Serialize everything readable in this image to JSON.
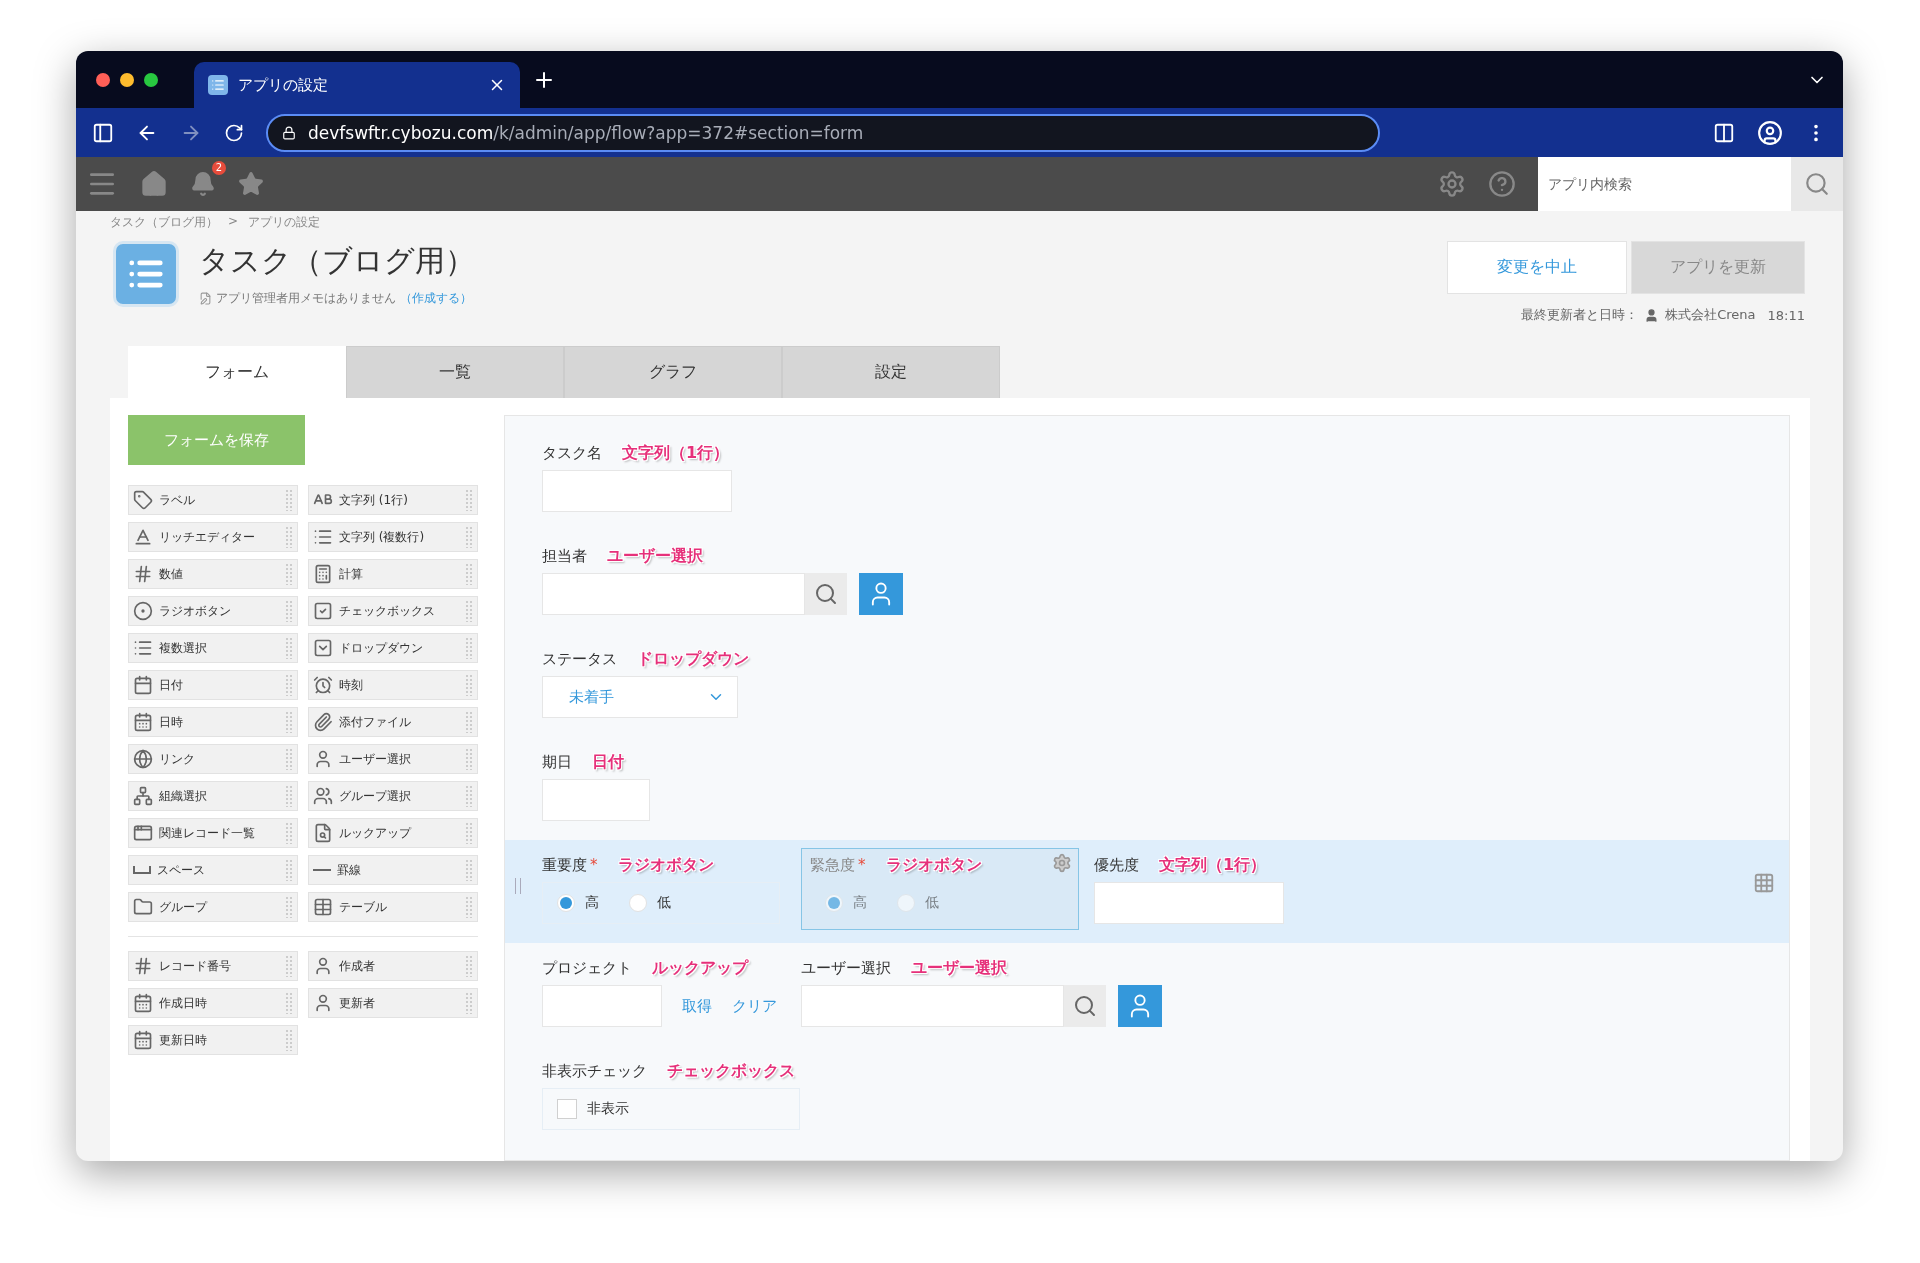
{
  "browser": {
    "tab_title": "アプリの設定",
    "url_host": "devfswftr.cybozu.com",
    "url_path": "/k/admin/app/flow?app=372#section=form"
  },
  "header": {
    "notification_count": "2",
    "search_placeholder": "アプリ内検索"
  },
  "breadcrumb": {
    "items": [
      "タスク（ブログ用）",
      "アプリの設定"
    ],
    "separator": ">"
  },
  "app": {
    "title": "タスク（ブログ用）",
    "memo": "アプリ管理者用メモはありません",
    "memo_link": "（作成する）"
  },
  "actions": [
    {
      "label": "変更を中止",
      "disabled": false
    },
    {
      "label": "アプリを更新",
      "disabled": true
    }
  ],
  "last_updated": {
    "label": "最終更新者と日時：",
    "user": "株式会社Crena",
    "time": "18:11"
  },
  "tabs": [
    {
      "label": "フォーム",
      "selected": true
    },
    {
      "label": "一覧",
      "selected": false
    },
    {
      "label": "グラフ",
      "selected": false
    },
    {
      "label": "設定",
      "selected": false
    }
  ],
  "palette": {
    "save_button": "フォームを保存",
    "groups": [
      [
        {
          "kind": "label",
          "label": "ラベル"
        },
        {
          "kind": "single_line",
          "label": "文字列 (1行)"
        },
        {
          "kind": "rich_text",
          "label": "リッチエディター"
        },
        {
          "kind": "multi_line",
          "label": "文字列 (複数行)"
        },
        {
          "kind": "number",
          "label": "数値"
        },
        {
          "kind": "calc",
          "label": "計算"
        },
        {
          "kind": "radio",
          "label": "ラジオボタン"
        },
        {
          "kind": "checkbox",
          "label": "チェックボックス"
        },
        {
          "kind": "multi_select",
          "label": "複数選択"
        },
        {
          "kind": "dropdown",
          "label": "ドロップダウン"
        },
        {
          "kind": "date",
          "label": "日付"
        },
        {
          "kind": "time",
          "label": "時刻"
        },
        {
          "kind": "datetime",
          "label": "日時"
        },
        {
          "kind": "file",
          "label": "添付ファイル"
        },
        {
          "kind": "link",
          "label": "リンク"
        },
        {
          "kind": "user",
          "label": "ユーザー選択"
        },
        {
          "kind": "org",
          "label": "組織選択"
        },
        {
          "kind": "group_select",
          "label": "グループ選択"
        },
        {
          "kind": "related",
          "label": "関連レコード一覧"
        },
        {
          "kind": "lookup",
          "label": "ルックアップ"
        },
        {
          "kind": "space",
          "label": "スペース"
        },
        {
          "kind": "rule",
          "label": "罫線"
        },
        {
          "kind": "group",
          "label": "グループ"
        },
        {
          "kind": "table",
          "label": "テーブル"
        }
      ],
      [
        {
          "kind": "number",
          "label": "レコード番号"
        },
        {
          "kind": "user",
          "label": "作成者"
        },
        {
          "kind": "datetime",
          "label": "作成日時"
        },
        {
          "kind": "user",
          "label": "更新者"
        },
        {
          "kind": "datetime",
          "label": "更新日時"
        }
      ]
    ]
  },
  "form": {
    "rows": [
      {
        "highlighted": false,
        "fields": [
          {
            "kind": "text",
            "label": "タスク名",
            "type_tag": "文字列（1行）",
            "selected": false
          }
        ]
      },
      {
        "highlighted": false,
        "fields": [
          {
            "kind": "user",
            "label": "担当者",
            "type_tag": "ユーザー選択",
            "selected": false
          }
        ]
      },
      {
        "highlighted": false,
        "fields": [
          {
            "kind": "dropdown",
            "label": "ステータス",
            "type_tag": "ドロップダウン",
            "selected": false,
            "value": "未着手"
          }
        ]
      },
      {
        "highlighted": false,
        "fields": [
          {
            "kind": "date",
            "label": "期日",
            "type_tag": "日付",
            "selected": false
          }
        ]
      },
      {
        "highlighted": true,
        "fields": [
          {
            "kind": "radio",
            "label": "重要度",
            "type_tag": "ラジオボタン",
            "required_mark": "*",
            "selected": false,
            "options": [
              {
                "label": "高",
                "checked": true
              },
              {
                "label": "低",
                "checked": false
              }
            ]
          },
          {
            "kind": "radio",
            "label": "緊急度",
            "type_tag": "ラジオボタン",
            "required_mark": "*",
            "selected": true,
            "options": [
              {
                "label": "高",
                "checked": true
              },
              {
                "label": "低",
                "checked": false
              }
            ]
          },
          {
            "kind": "text",
            "label": "優先度",
            "type_tag": "文字列（1行）",
            "selected": false
          }
        ]
      },
      {
        "highlighted": false,
        "fields": [
          {
            "kind": "lookup",
            "label": "プロジェクト",
            "type_tag": "ルックアップ",
            "selected": false,
            "links": [
              "取得",
              "クリア"
            ]
          },
          {
            "kind": "user",
            "label": "ユーザー選択",
            "type_tag": "ユーザー選択",
            "selected": false
          }
        ]
      },
      {
        "highlighted": false,
        "fields": [
          {
            "kind": "checkbox",
            "label": "非表示チェック",
            "type_tag": "チェックボックス",
            "selected": false,
            "options": [
              {
                "label": "非表示",
                "checked": false
              }
            ]
          }
        ]
      }
    ]
  }
}
